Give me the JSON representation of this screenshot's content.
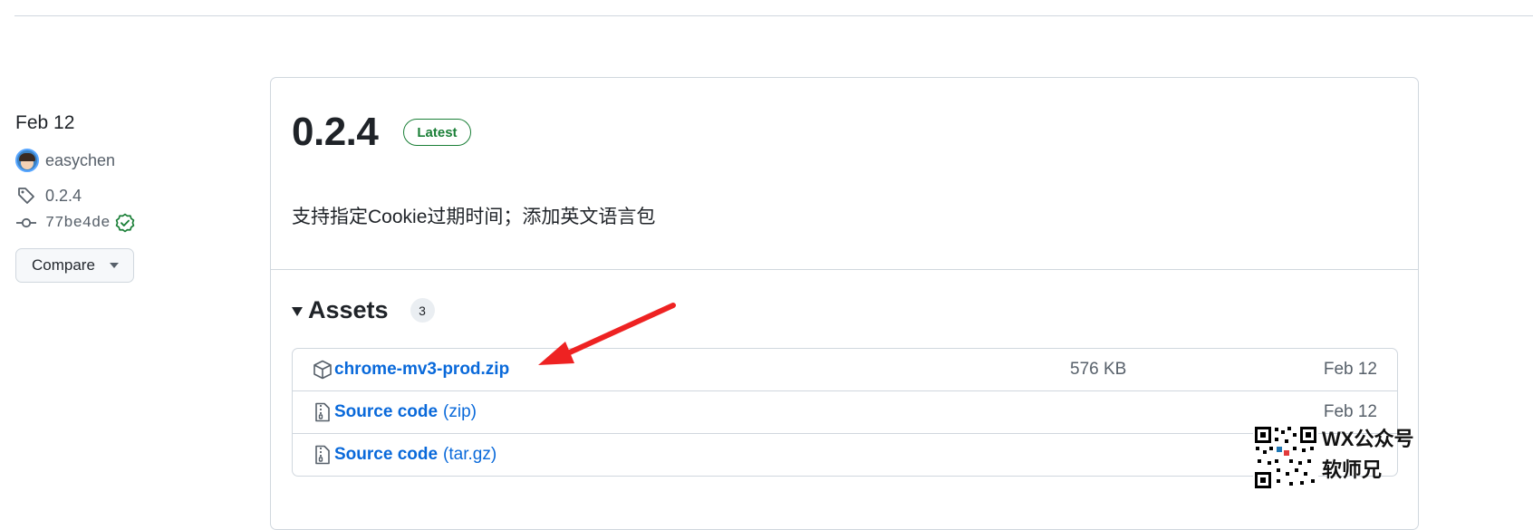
{
  "meta": {
    "date": "Feb 12",
    "author": "easychen",
    "tag": "0.2.4",
    "commit": "77be4de",
    "compare_label": "Compare"
  },
  "release": {
    "title": "0.2.4",
    "badge": "Latest",
    "body": "支持指定Cookie过期时间；添加英文语言包"
  },
  "assets": {
    "title": "Assets",
    "count": "3",
    "items": [
      {
        "name": "chrome-mv3-prod.zip",
        "suffix": "",
        "size": "576 KB",
        "date": "Feb 12",
        "icon": "package-icon"
      },
      {
        "name": "Source code",
        "suffix": "(zip)",
        "size": "",
        "date": "Feb 12",
        "icon": "file-zip-icon"
      },
      {
        "name": "Source code",
        "suffix": "(tar.gz)",
        "size": "",
        "date": "",
        "icon": "file-zip-icon"
      }
    ]
  },
  "watermark": {
    "line1": "WX公众号",
    "line2": "软师兄"
  },
  "colors": {
    "link": "#0969da",
    "latest": "#1a7f37",
    "annotation_arrow": "#ee2222"
  }
}
